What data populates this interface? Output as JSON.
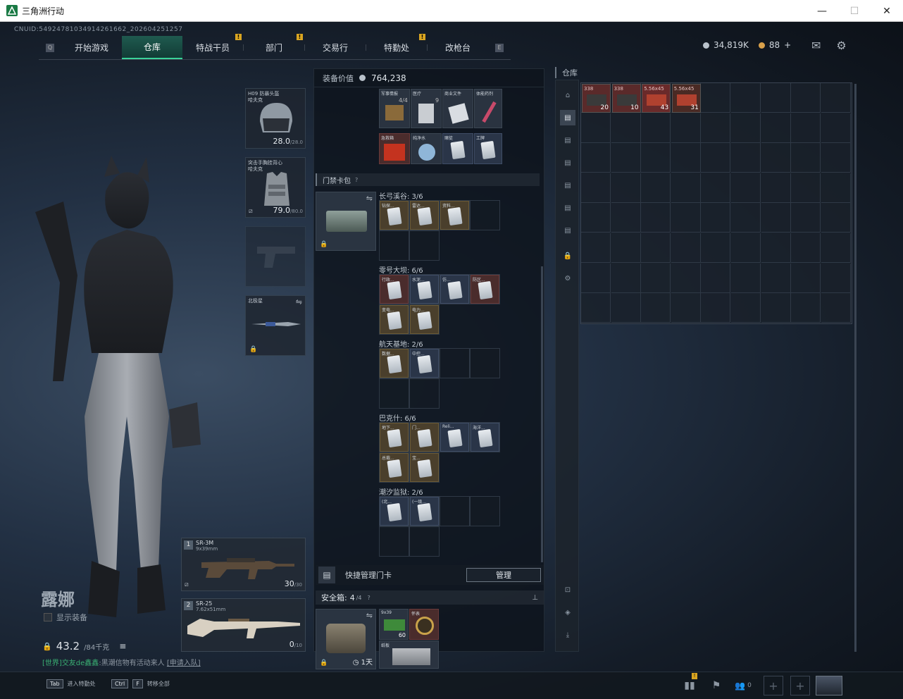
{
  "window": {
    "title": "三角洲行动",
    "minimize": "—",
    "maximize": "☐",
    "close": "✕"
  },
  "uid": "CNUID:5492478103491426166​2_202604251257",
  "nav": {
    "tabs": [
      {
        "label": "开始游戏",
        "badge": false
      },
      {
        "label": "仓库",
        "badge": false,
        "active": true
      },
      {
        "label": "特战干员",
        "badge": true
      },
      {
        "label": "部门",
        "badge": true
      },
      {
        "label": "交易行",
        "badge": false
      },
      {
        "label": "特勤处",
        "badge": true
      },
      {
        "label": "改枪台",
        "badge": false
      }
    ],
    "badge_text": "!",
    "left_key": "Q",
    "right_key": "E"
  },
  "currency": {
    "hafu": "34,819K",
    "coupon": "88",
    "plus": "+"
  },
  "character": {
    "name": "露娜",
    "show_equipment": "显示装备",
    "weight": "43.2",
    "weight_max": "/84千克"
  },
  "chat": {
    "channel": "[世界]",
    "user": "交友de鑫鑫",
    "text": "黑潮信物有活动来人",
    "link": "[申请入队]"
  },
  "equipment": [
    {
      "label": "H09 防暴头盔\n哈夫克",
      "dur": "28.0",
      "max": "/28.0"
    },
    {
      "label": "突击手胸挂背心\n哈夫克",
      "dur": "79.0",
      "max": "/80.0"
    },
    {
      "label": "",
      "dur": "",
      "max": ""
    },
    {
      "label": "北极星",
      "dur": "",
      "max": ""
    }
  ],
  "weapons": [
    {
      "num": "1",
      "name": "SR-3M",
      "caliber": "9x39mm",
      "ammo": "30",
      "max": "/30"
    },
    {
      "num": "2",
      "name": "SR-25",
      "caliber": "7.62x51mm",
      "ammo": "0",
      "max": "/10"
    }
  ],
  "loadout": {
    "value_label": "装备价值",
    "value": "764,238",
    "top_items": [
      "军事情报",
      "医疗",
      "商业文件",
      "体能药剂",
      "急救箱",
      "纯净水",
      "赌徒",
      "工牌"
    ],
    "top_count": "4/4",
    "top_count2": "9",
    "cardbag_title": "门禁卡包",
    "cardbag_help": "?",
    "groups": [
      {
        "name": "长弓溪谷: 3/6",
        "cards": [
          "钻探...",
          "雷达...",
          "资料..."
        ],
        "colors": [
          "gold",
          "gold",
          "gold"
        ]
      },
      {
        "name": "零号大坝: 6/6",
        "cards": [
          "行政...",
          "水泥...",
          "仿...",
          "防区..."
        ],
        "colors": [
          "red",
          "blue",
          "blue",
          "red"
        ],
        "row2": [
          "变电...",
          "电力..."
        ]
      },
      {
        "name": "航天基地: 2/6",
        "cards": [
          "数据...",
          "中控..."
        ],
        "colors": [
          "gold",
          "blue"
        ]
      },
      {
        "name": "巴克什: 6/6",
        "cards": [
          "地下...",
          "门...",
          "Reli...",
          "海洋..."
        ],
        "colors": [
          "gold",
          "gold",
          "blue",
          "blue"
        ],
        "row2": [
          "总裁...",
          "宝..."
        ]
      },
      {
        "name": "潮汐监狱: 2/6",
        "cards": [
          "(北...",
          "(一级..."
        ],
        "colors": [
          "blue",
          "blue"
        ]
      }
    ],
    "quick_manage": "快捷管理门卡",
    "manage_btn": "管理",
    "safe_title": "安全箱:",
    "safe_count": "4",
    "safe_max": "/4",
    "safe_help": "?",
    "safe_time": "1天",
    "safe_items": [
      {
        "name": "9x39",
        "qty": "60"
      },
      {
        "name": "怀表"
      },
      {
        "name": "纸板"
      }
    ]
  },
  "stash": {
    "title": "仓库",
    "items": [
      {
        "name": "338",
        "qty": "20"
      },
      {
        "name": "338",
        "qty": "10"
      },
      {
        "name": "5.56x45",
        "qty": "43"
      },
      {
        "name": "5.56x45",
        "qty": "31"
      }
    ]
  },
  "bottom": {
    "tab_key": "Tab",
    "tab_label": "进入特勤处",
    "ctrl_key": "Ctrl",
    "f_key": "F",
    "ctrl_label": "转移全部",
    "friend_count": "0",
    "plus": "+"
  }
}
